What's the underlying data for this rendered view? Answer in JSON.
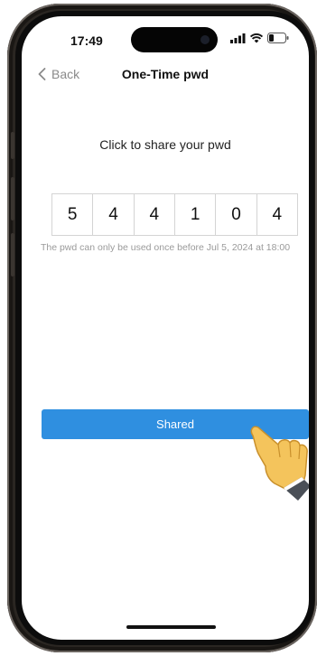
{
  "status_bar": {
    "time": "17:49"
  },
  "nav": {
    "back_label": "Back",
    "title": "One-Time pwd"
  },
  "main": {
    "share_prompt": "Click to share your pwd",
    "code_digits": [
      "5",
      "4",
      "4",
      "1",
      "0",
      "4"
    ],
    "note": "The pwd can only be used once before Jul 5, 2024 at 18:00",
    "shared_button_label": "Shared"
  },
  "colors": {
    "accent": "#2f8fe0",
    "title": "#111111",
    "muted": "#9a9a9a"
  },
  "icons": [
    "chevron-left-icon",
    "signal-icon",
    "wifi-icon",
    "battery-icon",
    "pointing-hand-icon"
  ]
}
